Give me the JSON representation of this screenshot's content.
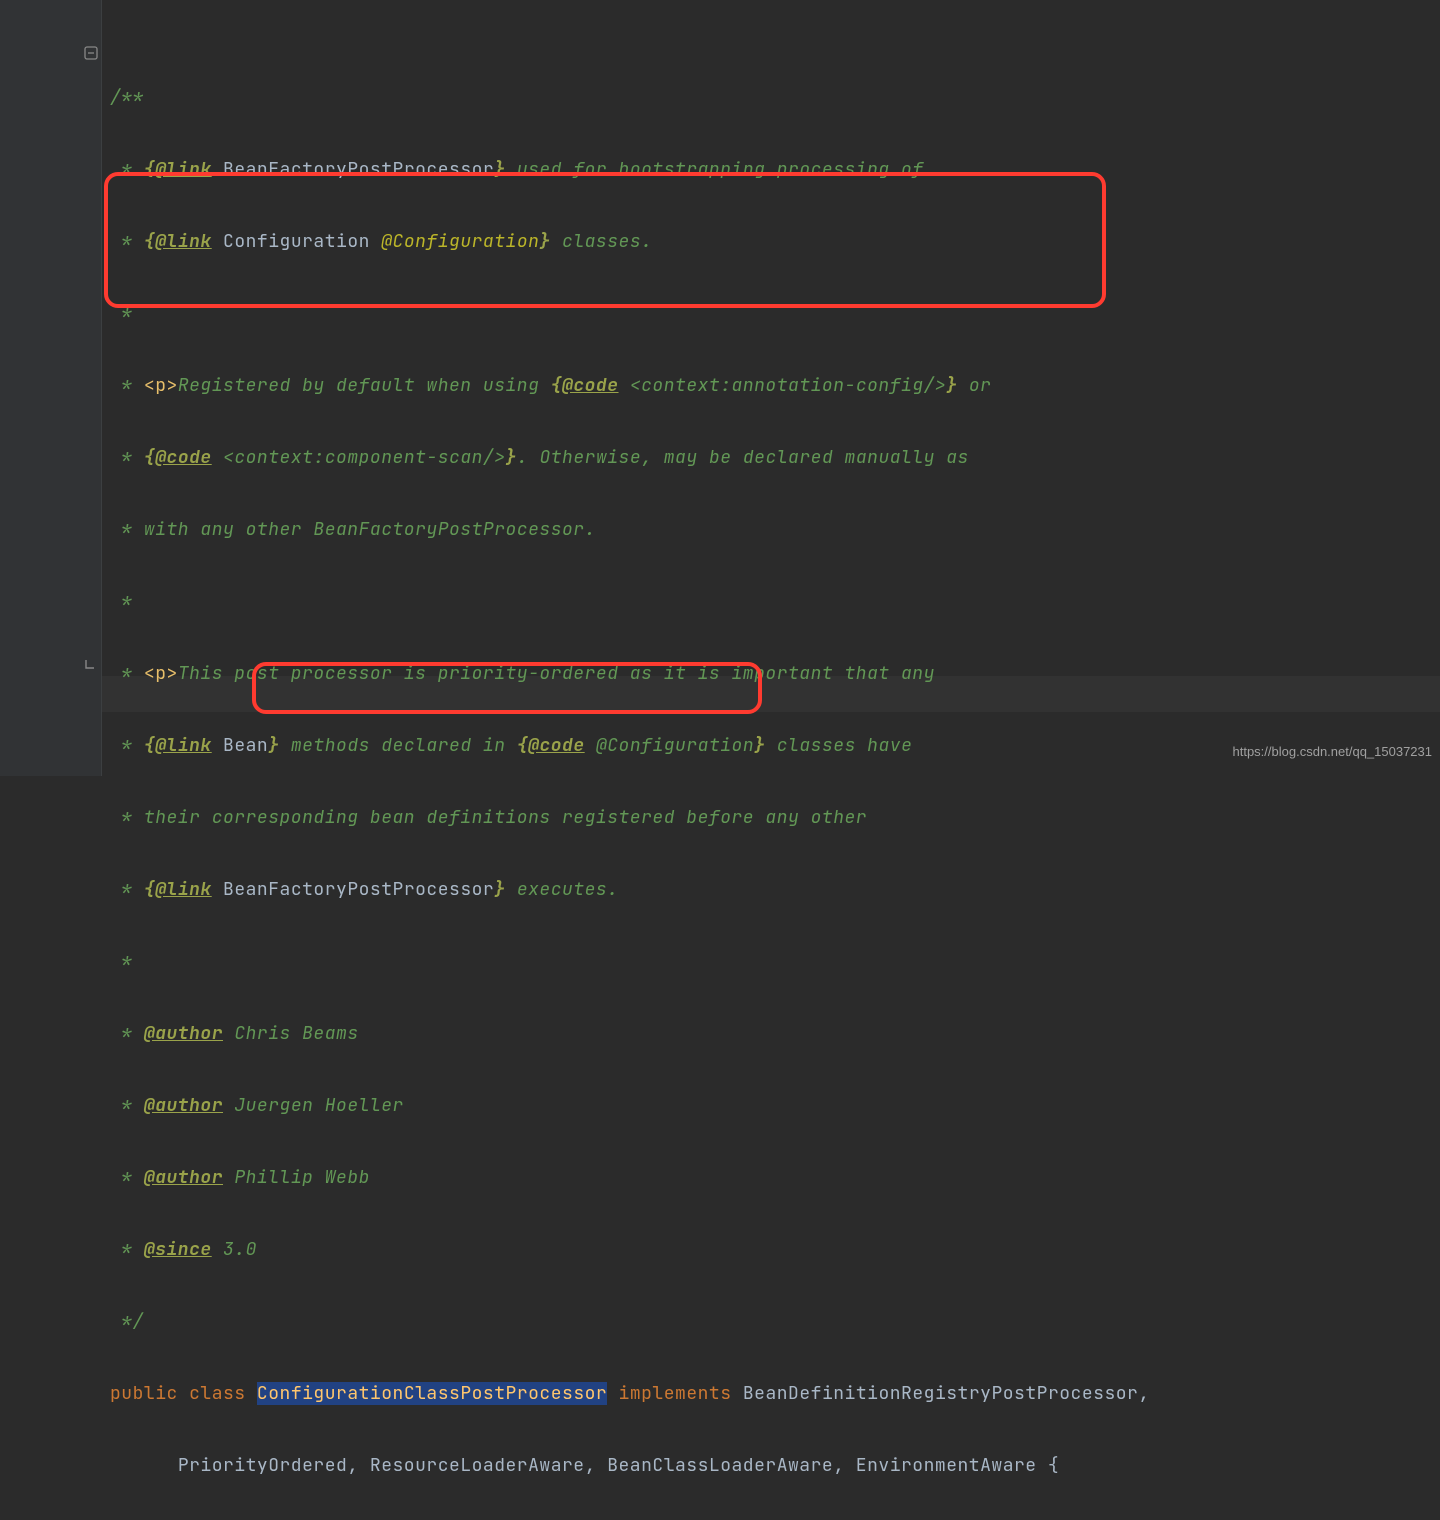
{
  "code": {
    "l1": "/**",
    "l2_pre": " * ",
    "l2_br": "{",
    "l2_tag": "@link",
    "l2_name": " BeanFactoryPostProcessor",
    "l2_br2": "}",
    "l2_rest": " used for bootstrapping processing of",
    "l3_pre": " * ",
    "l3_br": "{",
    "l3_tag": "@link",
    "l3_name": " Configuration",
    "l3_ann": " @Configuration",
    "l3_br2": "}",
    "l3_rest": " classes.",
    "l4": " *",
    "l5_pre": " * ",
    "l5_p": "<p>",
    "l5_txt": "Registered by default when using ",
    "l5_br": "{",
    "l5_tag": "@code",
    "l5_code": " <context:annotation-config/>",
    "l5_br2": "}",
    "l5_rest": " or",
    "l6_pre": " * ",
    "l6_br": "{",
    "l6_tag": "@code",
    "l6_code": " <context:component-scan/>",
    "l6_br2": "}",
    "l6_rest": ". Otherwise, may be declared manually as",
    "l7": " * with any other BeanFactoryPostProcessor.",
    "l8": " *",
    "l9_pre": " * ",
    "l9_p": "<p>",
    "l9_txt": "This post processor is priority-ordered as it is important that any",
    "l10_pre": " * ",
    "l10_br": "{",
    "l10_tag": "@link",
    "l10_name": " Bean",
    "l10_br2": "}",
    "l10_mid": " methods declared in ",
    "l10_br3": "{",
    "l10_tag2": "@code",
    "l10_code": " @Configuration",
    "l10_br4": "}",
    "l10_rest": " classes have",
    "l11": " * their corresponding bean definitions registered before any other",
    "l12_pre": " * ",
    "l12_br": "{",
    "l12_tag": "@link",
    "l12_name": " BeanFactoryPostProcessor",
    "l12_br2": "}",
    "l12_rest": " executes.",
    "l13": " *",
    "l14_pre": " * ",
    "l14_tag": "@author",
    "l14_val": " Chris Beams",
    "l15_pre": " * ",
    "l15_tag": "@author",
    "l15_val": " Juergen Hoeller",
    "l16_pre": " * ",
    "l16_tag": "@author",
    "l16_val": " Phillip Webb",
    "l17_pre": " * ",
    "l17_tag": "@since",
    "l17_val": " 3.0",
    "l18": " */",
    "l19_public": "public ",
    "l19_class": "class ",
    "l19_name": "ConfigurationClassPostProcessor",
    "l19_impl": " implements ",
    "l19_rest": "BeanDefinitionRegistryPostProcessor,",
    "l20_indent": "      ",
    "l20_rest": "PriorityOrdered, ResourceLoaderAware, BeanClassLoaderAware, EnvironmentAware {"
  },
  "watermark": "https://blog.csdn.net/qq_15037231"
}
